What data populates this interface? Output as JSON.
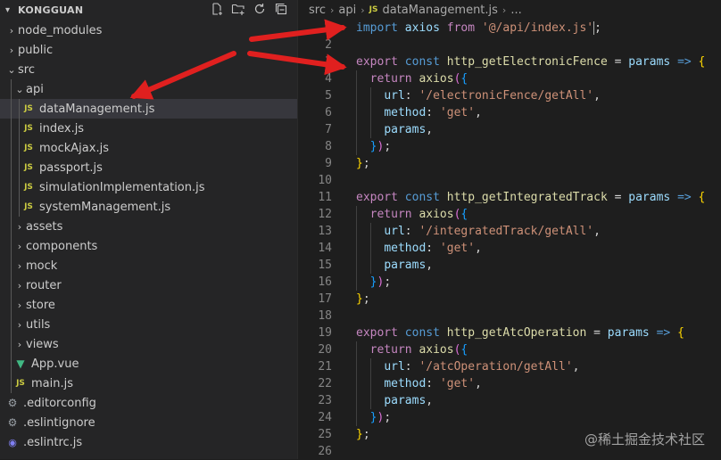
{
  "explorer": {
    "project": "KONGGUAN",
    "actions": [
      "new-file-icon",
      "new-folder-icon",
      "refresh-icon",
      "collapse-all-icon"
    ],
    "items": [
      {
        "label": "node_modules",
        "type": "folder",
        "open": false,
        "depth": 0
      },
      {
        "label": "public",
        "type": "folder",
        "open": false,
        "depth": 0
      },
      {
        "label": "src",
        "type": "folder",
        "open": true,
        "depth": 0
      },
      {
        "label": "api",
        "type": "folder",
        "open": true,
        "depth": 1
      },
      {
        "label": "dataManagement.js",
        "type": "js",
        "depth": 2,
        "selected": true
      },
      {
        "label": "index.js",
        "type": "js",
        "depth": 2
      },
      {
        "label": "mockAjax.js",
        "type": "js",
        "depth": 2
      },
      {
        "label": "passport.js",
        "type": "js",
        "depth": 2
      },
      {
        "label": "simulationImplementation.js",
        "type": "js",
        "depth": 2
      },
      {
        "label": "systemManagement.js",
        "type": "js",
        "depth": 2
      },
      {
        "label": "assets",
        "type": "folder",
        "open": false,
        "depth": 1
      },
      {
        "label": "components",
        "type": "folder",
        "open": false,
        "depth": 1
      },
      {
        "label": "mock",
        "type": "folder",
        "open": false,
        "depth": 1
      },
      {
        "label": "router",
        "type": "folder",
        "open": false,
        "depth": 1
      },
      {
        "label": "store",
        "type": "folder",
        "open": false,
        "depth": 1
      },
      {
        "label": "utils",
        "type": "folder",
        "open": false,
        "depth": 1
      },
      {
        "label": "views",
        "type": "folder",
        "open": false,
        "depth": 1
      },
      {
        "label": "App.vue",
        "type": "vue",
        "depth": 1
      },
      {
        "label": "main.js",
        "type": "js",
        "depth": 1
      },
      {
        "label": ".editorconfig",
        "type": "config",
        "depth": 0
      },
      {
        "label": ".eslintignore",
        "type": "config",
        "depth": 0
      },
      {
        "label": ".eslintrc.js",
        "type": "eslint",
        "depth": 0
      }
    ]
  },
  "breadcrumb": {
    "parts": [
      "src",
      "api",
      "dataManagement.js",
      "..."
    ],
    "file_badge": "JS"
  },
  "code": {
    "lines": [
      {
        "n": "1",
        "t": [
          [
            "k",
            "import"
          ],
          [
            "p",
            " "
          ],
          [
            "v",
            "axios"
          ],
          [
            "p",
            " "
          ],
          [
            "kc",
            "from"
          ],
          [
            "p",
            " "
          ],
          [
            "s",
            "'@/api/index.js'"
          ],
          [
            "cursor",
            ""
          ],
          [
            "p",
            ";"
          ]
        ]
      },
      {
        "n": "2",
        "t": []
      },
      {
        "n": "3",
        "t": [
          [
            "kc",
            "export"
          ],
          [
            "p",
            " "
          ],
          [
            "k",
            "const"
          ],
          [
            "p",
            " "
          ],
          [
            "f",
            "http_getElectronicFence"
          ],
          [
            "p",
            " = "
          ],
          [
            "v",
            "params"
          ],
          [
            "p",
            " "
          ],
          [
            "k",
            "=>"
          ],
          [
            "p",
            " "
          ],
          [
            "b1",
            "{"
          ]
        ]
      },
      {
        "n": "4",
        "t": [
          [
            "p",
            "  "
          ],
          [
            "kc",
            "return"
          ],
          [
            "p",
            " "
          ],
          [
            "f",
            "axios"
          ],
          [
            "b2",
            "("
          ],
          [
            "b3",
            "{"
          ]
        ]
      },
      {
        "n": "5",
        "t": [
          [
            "p",
            "    "
          ],
          [
            "v",
            "url"
          ],
          [
            "p",
            ": "
          ],
          [
            "s",
            "'/electronicFence/getAll'"
          ],
          [
            "p",
            ","
          ]
        ]
      },
      {
        "n": "6",
        "t": [
          [
            "p",
            "    "
          ],
          [
            "v",
            "method"
          ],
          [
            "p",
            ": "
          ],
          [
            "s",
            "'get'"
          ],
          [
            "p",
            ","
          ]
        ]
      },
      {
        "n": "7",
        "t": [
          [
            "p",
            "    "
          ],
          [
            "v",
            "params"
          ],
          [
            "p",
            ","
          ]
        ]
      },
      {
        "n": "8",
        "t": [
          [
            "p",
            "  "
          ],
          [
            "b3",
            "}"
          ],
          [
            "b2",
            ")"
          ],
          [
            "p",
            ";"
          ]
        ]
      },
      {
        "n": "9",
        "t": [
          [
            "b1",
            "}"
          ],
          [
            "p",
            ";"
          ]
        ]
      },
      {
        "n": "10",
        "t": []
      },
      {
        "n": "11",
        "t": [
          [
            "kc",
            "export"
          ],
          [
            "p",
            " "
          ],
          [
            "k",
            "const"
          ],
          [
            "p",
            " "
          ],
          [
            "f",
            "http_getIntegratedTrack"
          ],
          [
            "p",
            " = "
          ],
          [
            "v",
            "params"
          ],
          [
            "p",
            " "
          ],
          [
            "k",
            "=>"
          ],
          [
            "p",
            " "
          ],
          [
            "b1",
            "{"
          ]
        ]
      },
      {
        "n": "12",
        "t": [
          [
            "p",
            "  "
          ],
          [
            "kc",
            "return"
          ],
          [
            "p",
            " "
          ],
          [
            "f",
            "axios"
          ],
          [
            "b2",
            "("
          ],
          [
            "b3",
            "{"
          ]
        ]
      },
      {
        "n": "13",
        "t": [
          [
            "p",
            "    "
          ],
          [
            "v",
            "url"
          ],
          [
            "p",
            ": "
          ],
          [
            "s",
            "'/integratedTrack/getAll'"
          ],
          [
            "p",
            ","
          ]
        ]
      },
      {
        "n": "14",
        "t": [
          [
            "p",
            "    "
          ],
          [
            "v",
            "method"
          ],
          [
            "p",
            ": "
          ],
          [
            "s",
            "'get'"
          ],
          [
            "p",
            ","
          ]
        ]
      },
      {
        "n": "15",
        "t": [
          [
            "p",
            "    "
          ],
          [
            "v",
            "params"
          ],
          [
            "p",
            ","
          ]
        ]
      },
      {
        "n": "16",
        "t": [
          [
            "p",
            "  "
          ],
          [
            "b3",
            "}"
          ],
          [
            "b2",
            ")"
          ],
          [
            "p",
            ";"
          ]
        ]
      },
      {
        "n": "17",
        "t": [
          [
            "b1",
            "}"
          ],
          [
            "p",
            ";"
          ]
        ]
      },
      {
        "n": "18",
        "t": []
      },
      {
        "n": "19",
        "t": [
          [
            "kc",
            "export"
          ],
          [
            "p",
            " "
          ],
          [
            "k",
            "const"
          ],
          [
            "p",
            " "
          ],
          [
            "f",
            "http_getAtcOperation"
          ],
          [
            "p",
            " = "
          ],
          [
            "v",
            "params"
          ],
          [
            "p",
            " "
          ],
          [
            "k",
            "=>"
          ],
          [
            "p",
            " "
          ],
          [
            "b1",
            "{"
          ]
        ]
      },
      {
        "n": "20",
        "t": [
          [
            "p",
            "  "
          ],
          [
            "kc",
            "return"
          ],
          [
            "p",
            " "
          ],
          [
            "f",
            "axios"
          ],
          [
            "b2",
            "("
          ],
          [
            "b3",
            "{"
          ]
        ]
      },
      {
        "n": "21",
        "t": [
          [
            "p",
            "    "
          ],
          [
            "v",
            "url"
          ],
          [
            "p",
            ": "
          ],
          [
            "s",
            "'/atcOperation/getAll'"
          ],
          [
            "p",
            ","
          ]
        ]
      },
      {
        "n": "22",
        "t": [
          [
            "p",
            "    "
          ],
          [
            "v",
            "method"
          ],
          [
            "p",
            ": "
          ],
          [
            "s",
            "'get'"
          ],
          [
            "p",
            ","
          ]
        ]
      },
      {
        "n": "23",
        "t": [
          [
            "p",
            "    "
          ],
          [
            "v",
            "params"
          ],
          [
            "p",
            ","
          ]
        ]
      },
      {
        "n": "24",
        "t": [
          [
            "p",
            "  "
          ],
          [
            "b3",
            "}"
          ],
          [
            "b2",
            ")"
          ],
          [
            "p",
            ";"
          ]
        ]
      },
      {
        "n": "25",
        "t": [
          [
            "b1",
            "}"
          ],
          [
            "p",
            ";"
          ]
        ]
      },
      {
        "n": "26",
        "t": []
      }
    ]
  },
  "watermark": "@稀土掘金技术社区",
  "colors": {
    "arrow": "#e0201f",
    "selection": "#37373d",
    "js_icon": "#cbcb41",
    "vue_icon": "#41b883"
  }
}
